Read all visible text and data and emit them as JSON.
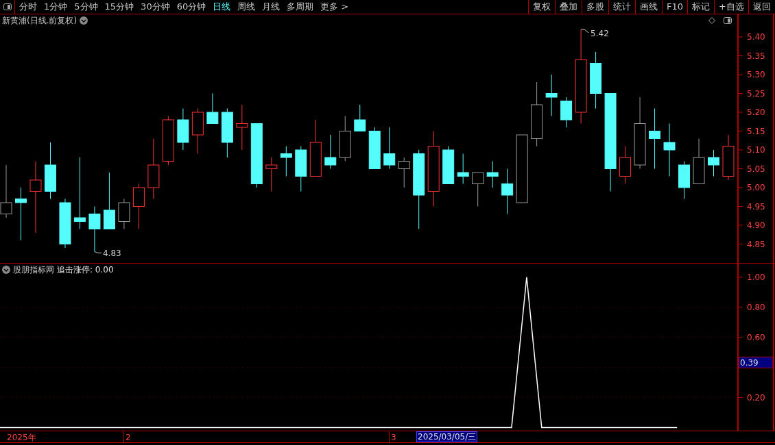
{
  "toolbar": {
    "tabs": [
      {
        "label": "分时",
        "selected": false
      },
      {
        "label": "1分钟",
        "selected": false
      },
      {
        "label": "5分钟",
        "selected": false
      },
      {
        "label": "15分钟",
        "selected": false
      },
      {
        "label": "30分钟",
        "selected": false
      },
      {
        "label": "60分钟",
        "selected": false
      },
      {
        "label": "日线",
        "selected": true
      },
      {
        "label": "周线",
        "selected": false
      },
      {
        "label": "月线",
        "selected": false
      },
      {
        "label": "多周期",
        "selected": false
      },
      {
        "label": "更多 >",
        "selected": false
      }
    ],
    "buttons": [
      "复权",
      "叠加",
      "多股",
      "统计",
      "画线",
      "F10",
      "标记",
      "+自选",
      "返回"
    ]
  },
  "price_chart": {
    "title": "新黄浦(日线.前复权)",
    "high_label": "5.42",
    "low_label": "4.83",
    "chart_data": {
      "type": "candlestick",
      "ylim": [
        4.8,
        5.46
      ],
      "yticks": [
        {
          "value": 5.4,
          "label": "5.40"
        },
        {
          "value": 5.35,
          "label": "5.35"
        },
        {
          "value": 5.3,
          "label": "5.30"
        },
        {
          "value": 5.25,
          "label": "5.25"
        },
        {
          "value": 5.2,
          "label": "5.20"
        },
        {
          "value": 5.15,
          "label": "5.15"
        },
        {
          "value": 5.1,
          "label": "5.10"
        },
        {
          "value": 5.05,
          "label": "5.05"
        },
        {
          "value": 5.0,
          "label": "5.00"
        },
        {
          "value": 4.95,
          "label": "4.95"
        },
        {
          "value": 4.9,
          "label": "4.90"
        },
        {
          "value": 4.85,
          "label": "4.85"
        }
      ],
      "ohlc": [
        [
          4.93,
          5.06,
          4.92,
          4.96
        ],
        [
          4.97,
          5.0,
          4.86,
          4.96
        ],
        [
          4.99,
          5.07,
          4.88,
          5.02
        ],
        [
          5.06,
          5.12,
          4.97,
          4.99
        ],
        [
          4.96,
          4.97,
          4.84,
          4.85
        ],
        [
          4.92,
          5.08,
          4.89,
          4.91
        ],
        [
          4.93,
          4.95,
          4.83,
          4.89
        ],
        [
          4.94,
          5.04,
          4.89,
          4.89
        ],
        [
          4.91,
          4.97,
          4.89,
          4.96
        ],
        [
          4.95,
          5.01,
          4.89,
          5.0
        ],
        [
          5.0,
          5.13,
          4.97,
          5.06
        ],
        [
          5.07,
          5.19,
          5.06,
          5.18
        ],
        [
          5.18,
          5.21,
          5.1,
          5.12
        ],
        [
          5.14,
          5.21,
          5.09,
          5.2
        ],
        [
          5.2,
          5.25,
          5.17,
          5.17
        ],
        [
          5.2,
          5.21,
          5.08,
          5.12
        ],
        [
          5.16,
          5.22,
          5.1,
          5.17
        ],
        [
          5.17,
          5.17,
          5.0,
          5.01
        ],
        [
          5.05,
          5.08,
          4.99,
          5.06
        ],
        [
          5.09,
          5.11,
          5.03,
          5.08
        ],
        [
          5.1,
          5.11,
          4.99,
          5.03
        ],
        [
          5.03,
          5.18,
          5.03,
          5.12
        ],
        [
          5.08,
          5.14,
          5.05,
          5.06
        ],
        [
          5.08,
          5.19,
          5.07,
          5.15
        ],
        [
          5.18,
          5.22,
          5.15,
          5.15
        ],
        [
          5.15,
          5.16,
          5.05,
          5.05
        ],
        [
          5.09,
          5.16,
          5.05,
          5.06
        ],
        [
          5.05,
          5.08,
          5.0,
          5.07
        ],
        [
          5.09,
          5.1,
          4.89,
          4.98
        ],
        [
          4.99,
          5.15,
          4.95,
          5.11
        ],
        [
          5.1,
          5.11,
          5.01,
          5.01
        ],
        [
          5.04,
          5.09,
          5.01,
          5.03
        ],
        [
          5.01,
          5.04,
          4.95,
          5.04
        ],
        [
          5.04,
          5.07,
          5.0,
          5.03
        ],
        [
          5.01,
          5.05,
          4.93,
          4.98
        ],
        [
          4.96,
          5.14,
          4.96,
          5.14
        ],
        [
          5.13,
          5.28,
          5.11,
          5.22
        ],
        [
          5.25,
          5.3,
          5.19,
          5.24
        ],
        [
          5.23,
          5.24,
          5.16,
          5.18
        ],
        [
          5.2,
          5.42,
          5.17,
          5.34
        ],
        [
          5.33,
          5.36,
          5.21,
          5.25
        ],
        [
          5.25,
          5.25,
          4.99,
          5.05
        ],
        [
          5.03,
          5.11,
          5.01,
          5.08
        ],
        [
          5.06,
          5.24,
          5.05,
          5.17
        ],
        [
          5.15,
          5.21,
          5.05,
          5.13
        ],
        [
          5.12,
          5.17,
          5.03,
          5.1
        ],
        [
          5.06,
          5.07,
          4.97,
          5.0
        ],
        [
          5.01,
          5.13,
          5.01,
          5.08
        ],
        [
          5.08,
          5.1,
          5.03,
          5.06
        ],
        [
          5.03,
          5.14,
          5.02,
          5.11
        ]
      ],
      "colors": [
        "#9a9a9a",
        "#54fcfc",
        "#ff3232",
        "#54fcfc",
        "#54fcfc",
        "#54fcfc",
        "#54fcfc",
        "#54fcfc",
        "#9a9a9a",
        "#ff3232",
        "#ff3232",
        "#ff3232",
        "#54fcfc",
        "#ff3232",
        "#54fcfc",
        "#54fcfc",
        "#ff3232",
        "#54fcfc",
        "#ff3232",
        "#54fcfc",
        "#54fcfc",
        "#ff3232",
        "#54fcfc",
        "#9a9a9a",
        "#54fcfc",
        "#54fcfc",
        "#54fcfc",
        "#9a9a9a",
        "#54fcfc",
        "#ff3232",
        "#54fcfc",
        "#54fcfc",
        "#9a9a9a",
        "#54fcfc",
        "#54fcfc",
        "#9a9a9a",
        "#9a9a9a",
        "#54fcfc",
        "#54fcfc",
        "#ff3232",
        "#54fcfc",
        "#54fcfc",
        "#ff3232",
        "#9a9a9a",
        "#54fcfc",
        "#54fcfc",
        "#54fcfc",
        "#9a9a9a",
        "#54fcfc",
        "#ff3232"
      ]
    }
  },
  "indicator": {
    "source": "股朋指标网",
    "reading": ": 0.00",
    "current_value": "0.39",
    "chart_data": {
      "type": "line",
      "ylim": [
        -0.02,
        1.09
      ],
      "grid": true,
      "yticks": [
        {
          "value": 0.2,
          "label": "0.20"
        },
        {
          "value": 0.6,
          "label": "0.60"
        },
        {
          "value": 0.8,
          "label": "0.80"
        },
        {
          "value": 1.0,
          "label": "1.00"
        }
      ],
      "series": [
        {
          "name": "追击涨停",
          "color": "#ffffff",
          "values": [
            0,
            0,
            0,
            0,
            0,
            0,
            0,
            0,
            0,
            0,
            0,
            0,
            0,
            0,
            0,
            0,
            0,
            0,
            0,
            0,
            0,
            0,
            0,
            0,
            0,
            0,
            0,
            0,
            0,
            0,
            0,
            0,
            0,
            0,
            0,
            1,
            0,
            0,
            0,
            0,
            0,
            0,
            0,
            0,
            0,
            0,
            null,
            null,
            null,
            null
          ]
        }
      ]
    }
  },
  "timeline": {
    "labels": [
      "2025年",
      "2",
      "3"
    ],
    "cursor_date": "2025/03/05/三"
  }
}
